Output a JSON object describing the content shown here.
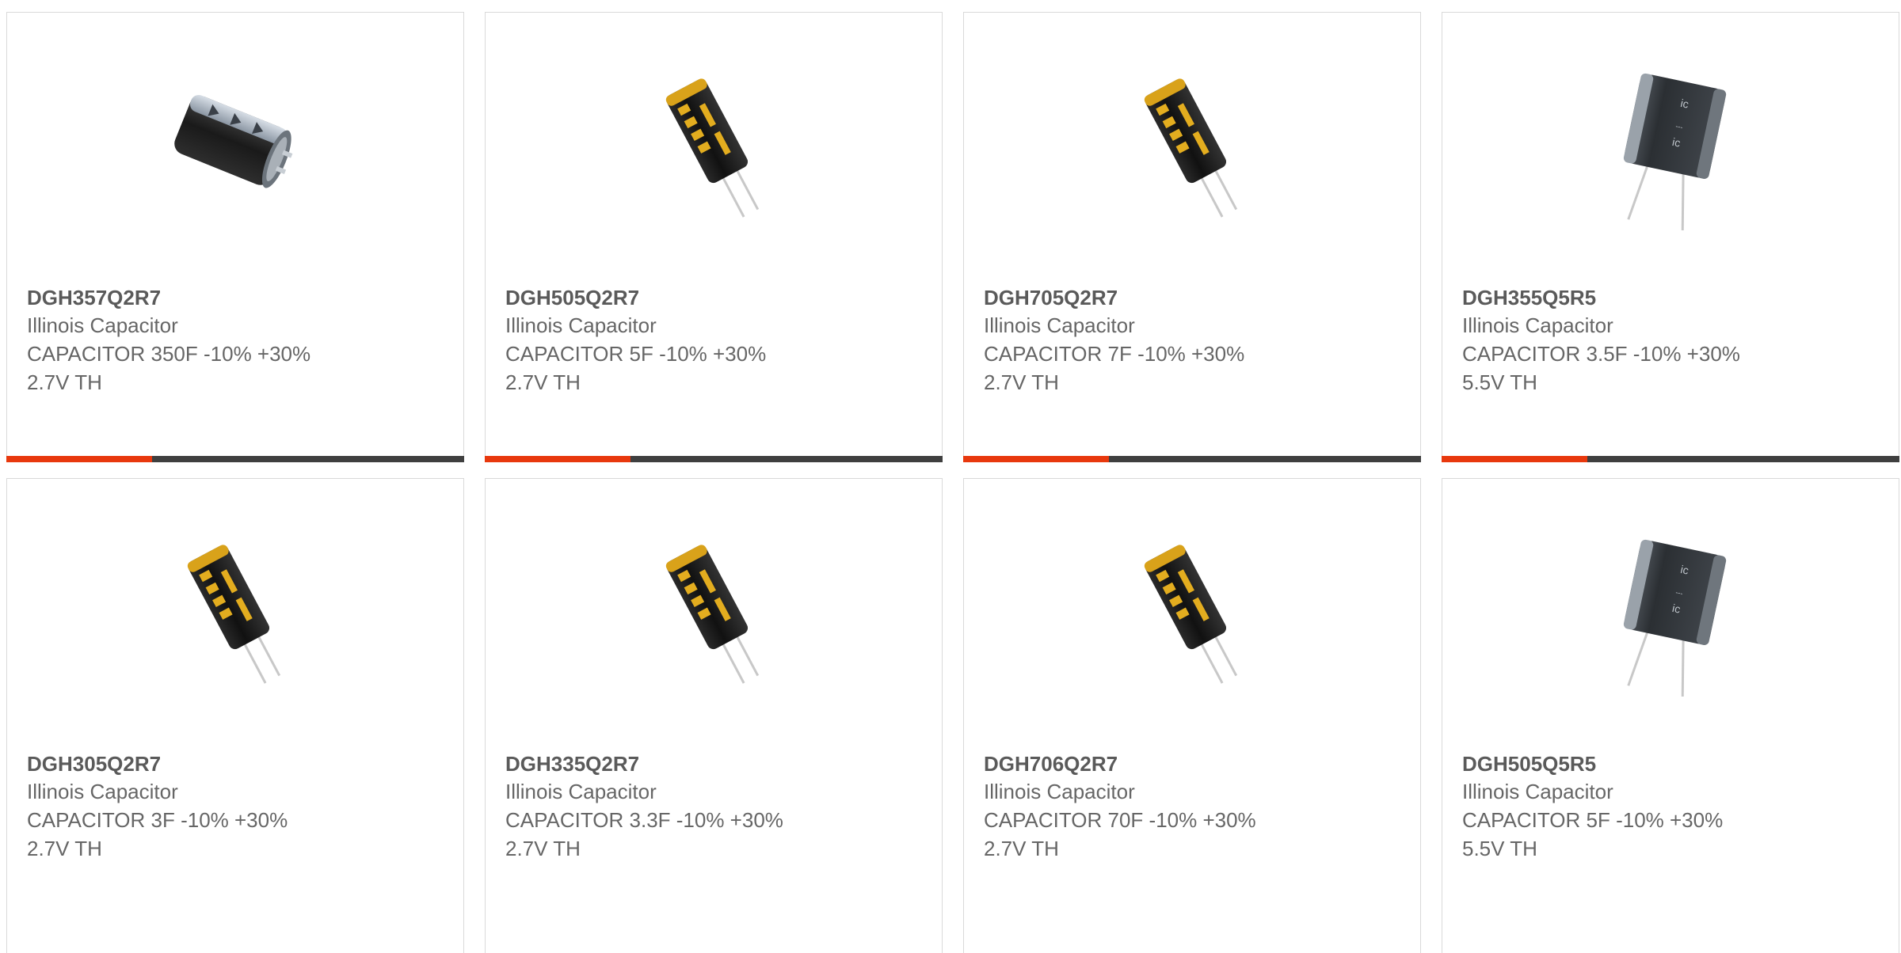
{
  "colors": {
    "accent": "#e8380d",
    "bar": "#3f3f3f",
    "text": "#666666",
    "border": "#d9d9d9"
  },
  "products": [
    {
      "part": "DGH357Q2R7",
      "maker": "Illinois Capacitor",
      "desc1": "CAPACITOR 350F -10% +30%",
      "desc2": "2.7V TH",
      "image": "capacitor-can-icon"
    },
    {
      "part": "DGH505Q2R7",
      "maker": "Illinois Capacitor",
      "desc1": "CAPACITOR 5F -10% +30%",
      "desc2": "2.7V TH",
      "image": "capacitor-radial-icon"
    },
    {
      "part": "DGH705Q2R7",
      "maker": "Illinois Capacitor",
      "desc1": "CAPACITOR 7F -10% +30%",
      "desc2": "2.7V TH",
      "image": "capacitor-radial-icon"
    },
    {
      "part": "DGH355Q5R5",
      "maker": "Illinois Capacitor",
      "desc1": "CAPACITOR 3.5F -10% +30%",
      "desc2": "5.5V TH",
      "image": "capacitor-module-icon"
    },
    {
      "part": "DGH305Q2R7",
      "maker": "Illinois Capacitor",
      "desc1": "CAPACITOR 3F -10% +30%",
      "desc2": "2.7V TH",
      "image": "capacitor-radial-icon"
    },
    {
      "part": "DGH335Q2R7",
      "maker": "Illinois Capacitor",
      "desc1": "CAPACITOR 3.3F -10% +30%",
      "desc2": "2.7V TH",
      "image": "capacitor-radial-icon"
    },
    {
      "part": "DGH706Q2R7",
      "maker": "Illinois Capacitor",
      "desc1": "CAPACITOR 70F -10% +30%",
      "desc2": "2.7V TH",
      "image": "capacitor-radial-icon"
    },
    {
      "part": "DGH505Q5R5",
      "maker": "Illinois Capacitor",
      "desc1": "CAPACITOR 5F -10% +30%",
      "desc2": "5.5V TH",
      "image": "capacitor-module-icon"
    }
  ]
}
